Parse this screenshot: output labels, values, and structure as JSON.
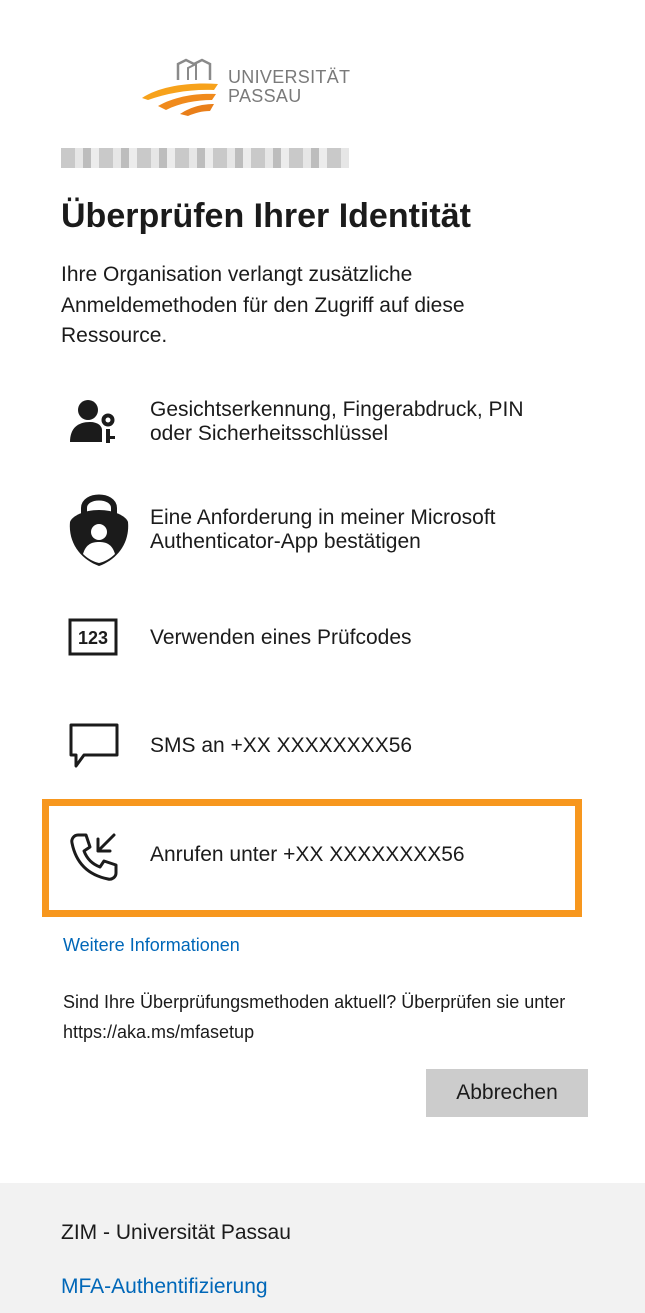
{
  "branding": {
    "logo_line1": "UNIVERSITÄT",
    "logo_line2": "PASSAU",
    "accent_color": "#f7971e"
  },
  "title": "Überprüfen Ihrer Identität",
  "description": "Ihre Organisation verlangt zusätzliche Anmeldemethoden für den Zugriff auf diese Ressource.",
  "methods": [
    {
      "label": "Gesichtserkennung, Fingerabdruck, PIN oder Sicherheitsschlüssel",
      "icon": "user-key-icon"
    },
    {
      "label": "Eine Anforderung in meiner Microsoft Authenticator-App bestätigen",
      "icon": "authenticator-lock-icon"
    },
    {
      "label": "Verwenden eines Prüfcodes",
      "icon": "verification-code-123-icon"
    },
    {
      "label": "SMS an +XX XXXXXXXX56",
      "icon": "sms-chat-icon"
    },
    {
      "label": "Anrufen unter +XX XXXXXXXX56",
      "icon": "phone-call-icon",
      "selected": true
    }
  ],
  "more_info_link": "Weitere Informationen",
  "update_note": "Sind Ihre Überprüfungsmethoden aktuell? Überprüfen sie unter https://aka.ms/mfasetup",
  "cancel_label": "Abbrechen",
  "footer": {
    "org": "ZIM - Universität Passau",
    "mfa_link": "MFA-Authentifizierung",
    "link_color": "#0067b8"
  }
}
